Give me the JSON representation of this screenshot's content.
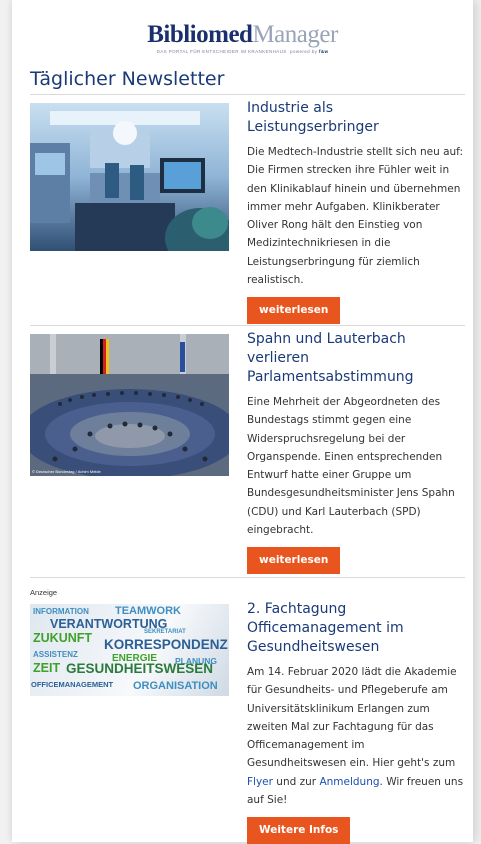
{
  "header": {
    "logo_part1": "Bibliomed",
    "logo_part2": "Manager",
    "tagline": "DAS PORTAL FÜR ENTSCHEIDER IM KRANKENHAUS",
    "tagline_powered": "powered by",
    "tagline_brand": "f&w"
  },
  "newsletter_title": "Täglicher Newsletter",
  "articles": [
    {
      "title": "Industrie als Leistungserbringer",
      "body": "Die Medtech-Industrie stellt sich neu auf: Die Firmen strecken ihre Fühler weit in den Klinikablauf hinein und übernehmen immer mehr Aufgaben. Klinikberater Oliver Rong hält den Einstieg von Medizintechnikriesen in die Leistungserbringung für ziemlich realistisch.",
      "button": "weiterlesen"
    },
    {
      "title": "Spahn und Lauterbach verlieren Parlamentsabstimmung",
      "body": "Eine Mehrheit der Abgeordneten des Bundestags stimmt gegen eine Widerspruchsregelung bei der Organspende. Einen entsprechenden Entwurf hatte einer Gruppe um Bundesgesundheitsminister Jens Spahn (CDU) und Karl Lauterbach (SPD) eingebracht.",
      "button": "weiterlesen",
      "photo_credit": "© Deutscher Bundestag / Achim Melde"
    }
  ],
  "ad": {
    "label": "Anzeige",
    "title": "2. Fachtagung Officemanagement im Gesundheitswesen",
    "body_part1": "Am 14. Februar 2020 lädt die Akademie für Gesundheits- und Pflegeberufe am Universitätsklinikum Erlangen zum zweiten Mal zur Fachtagung für das Officemanagement im Gesundheitswesen ein. Hier geht's zum ",
    "link1": "Flyer",
    "body_part2": " und zur ",
    "link2": "Anmeldung",
    "body_part3": ". Wir freuen uns auf Sie!",
    "button": "Weitere Infos",
    "word_cloud": [
      "INFORMATION",
      "TEAMWORK",
      "VERANTWORTUNG",
      "ZUKUNFT",
      "SEKRETARIAT",
      "KORRESPONDENZ",
      "ASSISTENZ",
      "ENERGIE",
      "PLANUNG",
      "ZEIT",
      "GESUNDHEITSWESEN",
      "OFFICEMANAGEMENT",
      "ORGANISATION"
    ]
  },
  "colors": {
    "title_blue": "#1a3a78",
    "button_orange": "#e8551f",
    "link_blue": "#1a4fb0"
  }
}
